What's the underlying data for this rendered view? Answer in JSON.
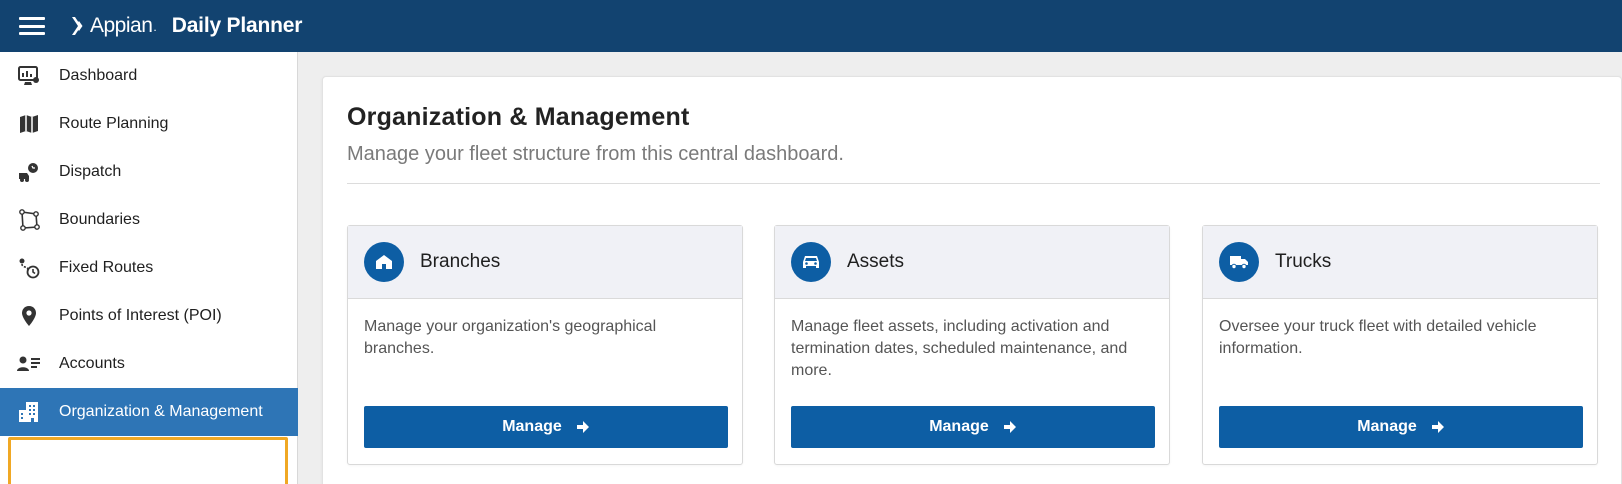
{
  "header": {
    "brand": "Appian",
    "brand_mark": ".",
    "app_title": "Daily Planner"
  },
  "sidebar": {
    "items": [
      {
        "label": "Dashboard",
        "icon": "dashboard-icon"
      },
      {
        "label": "Route Planning",
        "icon": "map-icon"
      },
      {
        "label": "Dispatch",
        "icon": "dispatch-icon"
      },
      {
        "label": "Boundaries",
        "icon": "boundary-icon"
      },
      {
        "label": "Fixed Routes",
        "icon": "route-clock-icon"
      },
      {
        "label": "Points of Interest (POI)",
        "icon": "map-pin-icon"
      },
      {
        "label": "Accounts",
        "icon": "accounts-icon"
      },
      {
        "label": "Organization & Management",
        "icon": "building-icon",
        "active": true
      }
    ]
  },
  "main": {
    "title": "Organization & Management",
    "subtitle": "Manage your fleet structure from this central dashboard.",
    "cards": [
      {
        "title": "Branches",
        "icon": "home-icon",
        "description": "Manage your organization's geographical branches.",
        "button": "Manage"
      },
      {
        "title": "Assets",
        "icon": "car-icon",
        "description": "Manage fleet assets, including activation and termination dates, scheduled maintenance, and more.",
        "button": "Manage"
      },
      {
        "title": "Trucks",
        "icon": "truck-icon",
        "description": "Oversee your truck fleet with detailed vehicle information.",
        "button": "Manage"
      }
    ]
  },
  "colors": {
    "header_bg": "#124370",
    "active_nav": "#2e75b6",
    "primary": "#0d5ea4",
    "focus": "#f0a824"
  }
}
